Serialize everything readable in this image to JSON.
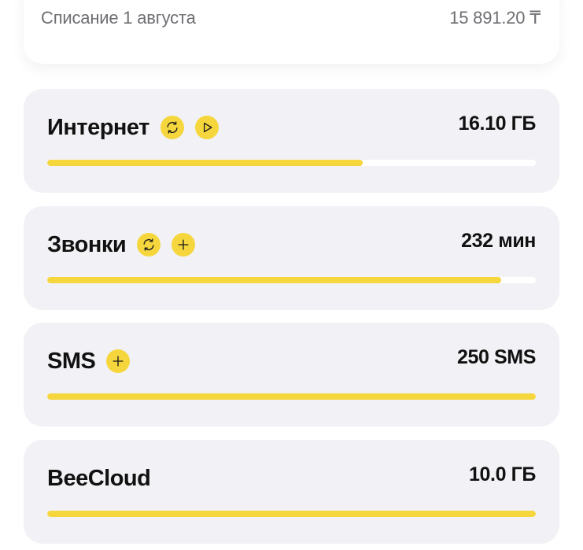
{
  "billing": {
    "label": "Списание 1 августа",
    "amount": "15 891.20 ₸"
  },
  "services": [
    {
      "id": "internet",
      "title": "Интернет",
      "amount": "16.10 ГБ",
      "progress": 0.645,
      "actions": [
        "refresh-icon",
        "play-icon"
      ]
    },
    {
      "id": "calls",
      "title": "Звонки",
      "amount": "232 мин",
      "progress": 0.929,
      "actions": [
        "refresh-icon",
        "plus-icon"
      ]
    },
    {
      "id": "sms",
      "title": "SMS",
      "amount": "250 SMS",
      "progress": 1.0,
      "actions": [
        "plus-icon"
      ]
    },
    {
      "id": "beecloud",
      "title": "BeeCloud",
      "amount": "10.0 ГБ",
      "progress": 1.0,
      "actions": []
    }
  ],
  "colors": {
    "accent": "#f5d63d",
    "card_background": "#f2f2f6",
    "track": "#ffffff",
    "muted_text": "#6e6e73"
  }
}
